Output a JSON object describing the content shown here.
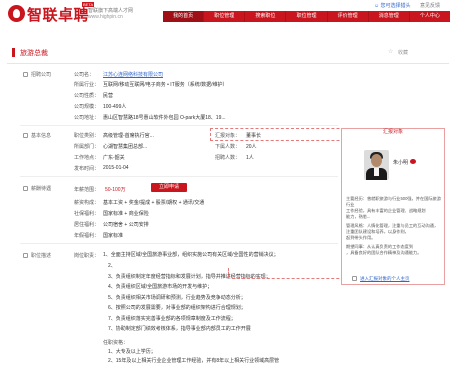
{
  "header": {
    "logo_text": "智联卓聘",
    "logo_badge": "BETA",
    "slogan": "智联旗下高端人才网",
    "domain": "www.highpin.cn",
    "top_links": [
      "☺ 您可选择猎头",
      "意见反馈"
    ]
  },
  "nav": {
    "items": [
      "我的首页",
      "职位管理",
      "搜索职位",
      "职位管理",
      "评价管理",
      "消息管理",
      "个人中心"
    ]
  },
  "page": {
    "title": "旅游总裁",
    "favorite": "收藏"
  },
  "company": {
    "section_label": "招聘公司",
    "rows": [
      {
        "label": "公司名：",
        "value": "江苏心连网络科技有限公司"
      },
      {
        "label": "所属行业：",
        "value": "互联网/移动互联网/电子商务 • IT服务（系统/数据/维护）"
      },
      {
        "label": "公司性质：",
        "value": "民营"
      },
      {
        "label": "公司规模：",
        "value": "100-499人"
      },
      {
        "label": "公司地址：",
        "value": "惠山区智慧路18号惠山软件外包园 O-park大厦18、19..."
      }
    ]
  },
  "basic": {
    "section_label": "基本信息",
    "rows": [
      {
        "label": "职位类别：",
        "value": "高级管理-首席执行官..."
      },
      {
        "label": "所属部门：",
        "value": "心湖智慧集团总部..."
      },
      {
        "label": "工作地点：",
        "value": "广东-韶关"
      },
      {
        "label": "发布时间：",
        "value": "2015-01-04"
      }
    ],
    "report_to_label": "汇报对象：",
    "report_to_value": "董事长",
    "subordinates_label": "下属人数：",
    "subordinates_value": "20人",
    "hire_count_label": "招聘人数：",
    "hire_count_value": "1人"
  },
  "salary_section": {
    "section_label": "薪酬待遇",
    "annual_label": "年薪范围：",
    "annual_value": "50-100万",
    "apply_button": "立即申请",
    "rows": [
      {
        "label": "薪资构成：",
        "value": "基本工资 + 奖金/提成 + 股票/期权 + 通讯/交通"
      },
      {
        "label": "社保福利：",
        "value": "国家标准 + 商业保险"
      },
      {
        "label": "居住福利：",
        "value": "公司宿舍 + 公司安排"
      },
      {
        "label": "年假福利：",
        "value": "国家标准"
      }
    ]
  },
  "description": {
    "section_label": "职位描述",
    "duties_label": "岗位职责：",
    "lines": [
      "1、全面主持区域/全国旅游事业部，组织实施公司有关区域/全国性的营销决议；",
      "2、",
      "3、负责组织制定年度经营指标和发展计划，指导并推进经营指标的实现；",
      "4、负责组织区域/全国旅游市场的开发与维护；",
      "5、负责组织相关市场调研和预测，行业趋势及竞争动态分析；",
      "6、按照公司的发展需要，对事业部的组织架构进行合理规划；",
      "7、负责组织落实完善事业部的各项规章制度及工作流程；",
      "7、协助制定部门绩效考核体系，指导事业部内部员工的工作开展"
    ],
    "qualification_label": "任职资格：",
    "qual_lines": [
      "1、大专及以上学历；",
      "2、15年及以上相关行业企业管理工作经验，并有8年以上相关行业领域高层管"
    ]
  },
  "report_card": {
    "title": "汇报对象",
    "name": "朱小明",
    "bio": [
      "主要经历：曾就职旅游与行业500强，并在国际旅游行业",
      "工作经验，具有丰富的企业管理、战略规划",
      "能力，熟悉...",
      "",
      "管理风格：人情化管理，注重与员工的互动沟通，",
      "注重团队建设和培养，以身作则，",
      "起到带头作用。",
      "",
      "期望同事：从认真负责的工作态度到",
      "，具备良好的团队合作精神及沟通能力。"
    ],
    "bottom_link": "进入汇报对象的个人主页"
  },
  "colors": {
    "brand": "#c9151e",
    "link": "#3366cc"
  }
}
